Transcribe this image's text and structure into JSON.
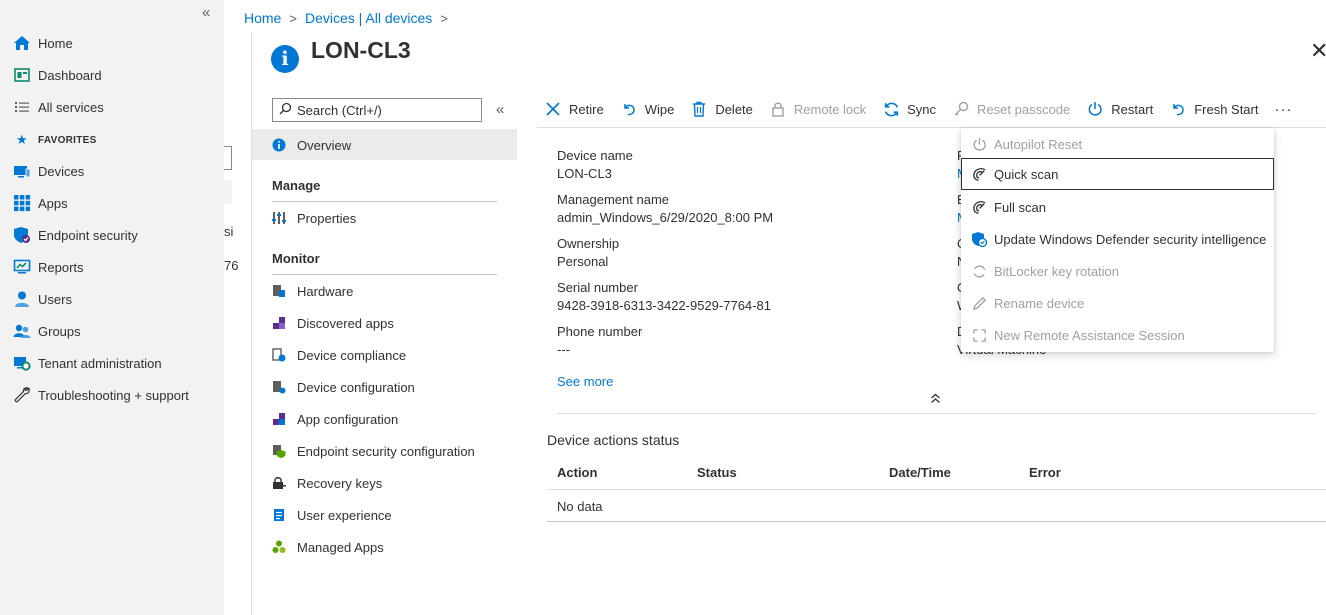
{
  "leftnav": {
    "items": [
      {
        "label": "Home"
      },
      {
        "label": "Dashboard"
      },
      {
        "label": "All services"
      }
    ],
    "favorites_label": "FAVORITES",
    "favorites": [
      {
        "label": "Devices"
      },
      {
        "label": "Apps"
      },
      {
        "label": "Endpoint security"
      },
      {
        "label": "Reports"
      },
      {
        "label": "Users"
      },
      {
        "label": "Groups"
      },
      {
        "label": "Tenant administration"
      },
      {
        "label": "Troubleshooting + support"
      }
    ]
  },
  "background": {
    "fragment1": "si",
    "fragment2": "76"
  },
  "breadcrumb": [
    "Home",
    "Devices | All devices"
  ],
  "title": "LON-CL3",
  "blade_menu": {
    "search_placeholder": "Search (Ctrl+/)",
    "overview": "Overview",
    "manage_header": "Manage",
    "manage_items": [
      {
        "label": "Properties"
      }
    ],
    "monitor_header": "Monitor",
    "monitor_items": [
      {
        "label": "Hardware"
      },
      {
        "label": "Discovered apps"
      },
      {
        "label": "Device compliance"
      },
      {
        "label": "Device configuration"
      },
      {
        "label": "App configuration"
      },
      {
        "label": "Endpoint security configuration"
      },
      {
        "label": "Recovery keys"
      },
      {
        "label": "User experience"
      },
      {
        "label": "Managed Apps"
      }
    ]
  },
  "toolbar": {
    "retire": "Retire",
    "wipe": "Wipe",
    "delete": "Delete",
    "remote_lock": "Remote lock",
    "sync": "Sync",
    "reset_passcode": "Reset passcode",
    "restart": "Restart",
    "fresh_start": "Fresh Start",
    "more": "···"
  },
  "essentials": {
    "device_name_label": "Device name",
    "device_name": "LON-CL3",
    "management_name_label": "Management name",
    "management_name": "admin_Windows_6/29/2020_8:00 PM",
    "ownership_label": "Ownership",
    "ownership": "Personal",
    "serial_label": "Serial number",
    "serial": "9428-3918-6313-3422-9529-7764-81",
    "phone_label": "Phone number",
    "phone": "---",
    "see_more": "See more",
    "right_col_peek": [
      "P",
      "M",
      "E",
      "M",
      "O",
      "N",
      "O",
      "W",
      "D"
    ],
    "right_col_value_peek": "Virtual Machine"
  },
  "actions_menu": {
    "items": [
      {
        "label": "Autopilot Reset",
        "disabled": true
      },
      {
        "label": "Quick scan",
        "disabled": false,
        "selected": true
      },
      {
        "label": "Full scan",
        "disabled": false
      },
      {
        "label": "Update Windows Defender security intelligence",
        "disabled": false
      },
      {
        "label": "BitLocker key rotation",
        "disabled": true
      },
      {
        "label": "Rename device",
        "disabled": true
      },
      {
        "label": "New Remote Assistance Session",
        "disabled": true
      }
    ]
  },
  "status": {
    "title": "Device actions status",
    "columns": [
      "Action",
      "Status",
      "Date/Time",
      "Error"
    ],
    "empty": "No data"
  },
  "colors": {
    "accent": "#0078d4",
    "disabled": "#a19f9d",
    "nav_bg": "#f2f2f2"
  }
}
